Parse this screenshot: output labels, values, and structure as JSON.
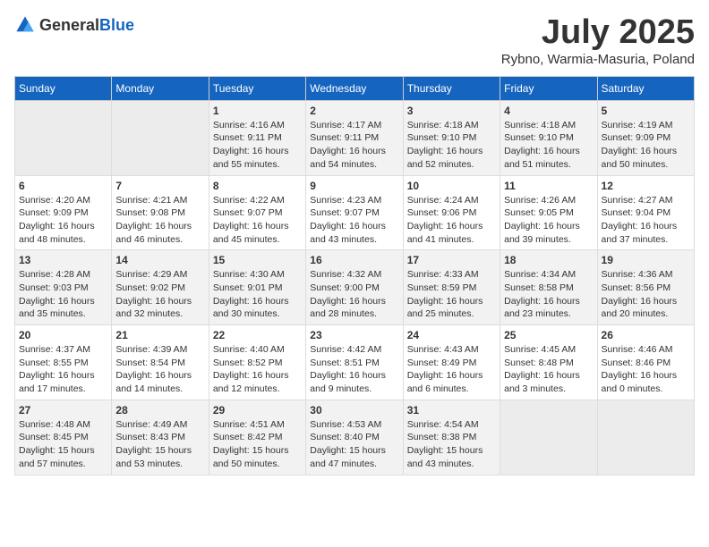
{
  "header": {
    "logo_general": "General",
    "logo_blue": "Blue",
    "month_year": "July 2025",
    "location": "Rybno, Warmia-Masuria, Poland"
  },
  "weekdays": [
    "Sunday",
    "Monday",
    "Tuesday",
    "Wednesday",
    "Thursday",
    "Friday",
    "Saturday"
  ],
  "weeks": [
    [
      {
        "day": "",
        "info": ""
      },
      {
        "day": "",
        "info": ""
      },
      {
        "day": "1",
        "info": "Sunrise: 4:16 AM\nSunset: 9:11 PM\nDaylight: 16 hours\nand 55 minutes."
      },
      {
        "day": "2",
        "info": "Sunrise: 4:17 AM\nSunset: 9:11 PM\nDaylight: 16 hours\nand 54 minutes."
      },
      {
        "day": "3",
        "info": "Sunrise: 4:18 AM\nSunset: 9:10 PM\nDaylight: 16 hours\nand 52 minutes."
      },
      {
        "day": "4",
        "info": "Sunrise: 4:18 AM\nSunset: 9:10 PM\nDaylight: 16 hours\nand 51 minutes."
      },
      {
        "day": "5",
        "info": "Sunrise: 4:19 AM\nSunset: 9:09 PM\nDaylight: 16 hours\nand 50 minutes."
      }
    ],
    [
      {
        "day": "6",
        "info": "Sunrise: 4:20 AM\nSunset: 9:09 PM\nDaylight: 16 hours\nand 48 minutes."
      },
      {
        "day": "7",
        "info": "Sunrise: 4:21 AM\nSunset: 9:08 PM\nDaylight: 16 hours\nand 46 minutes."
      },
      {
        "day": "8",
        "info": "Sunrise: 4:22 AM\nSunset: 9:07 PM\nDaylight: 16 hours\nand 45 minutes."
      },
      {
        "day": "9",
        "info": "Sunrise: 4:23 AM\nSunset: 9:07 PM\nDaylight: 16 hours\nand 43 minutes."
      },
      {
        "day": "10",
        "info": "Sunrise: 4:24 AM\nSunset: 9:06 PM\nDaylight: 16 hours\nand 41 minutes."
      },
      {
        "day": "11",
        "info": "Sunrise: 4:26 AM\nSunset: 9:05 PM\nDaylight: 16 hours\nand 39 minutes."
      },
      {
        "day": "12",
        "info": "Sunrise: 4:27 AM\nSunset: 9:04 PM\nDaylight: 16 hours\nand 37 minutes."
      }
    ],
    [
      {
        "day": "13",
        "info": "Sunrise: 4:28 AM\nSunset: 9:03 PM\nDaylight: 16 hours\nand 35 minutes."
      },
      {
        "day": "14",
        "info": "Sunrise: 4:29 AM\nSunset: 9:02 PM\nDaylight: 16 hours\nand 32 minutes."
      },
      {
        "day": "15",
        "info": "Sunrise: 4:30 AM\nSunset: 9:01 PM\nDaylight: 16 hours\nand 30 minutes."
      },
      {
        "day": "16",
        "info": "Sunrise: 4:32 AM\nSunset: 9:00 PM\nDaylight: 16 hours\nand 28 minutes."
      },
      {
        "day": "17",
        "info": "Sunrise: 4:33 AM\nSunset: 8:59 PM\nDaylight: 16 hours\nand 25 minutes."
      },
      {
        "day": "18",
        "info": "Sunrise: 4:34 AM\nSunset: 8:58 PM\nDaylight: 16 hours\nand 23 minutes."
      },
      {
        "day": "19",
        "info": "Sunrise: 4:36 AM\nSunset: 8:56 PM\nDaylight: 16 hours\nand 20 minutes."
      }
    ],
    [
      {
        "day": "20",
        "info": "Sunrise: 4:37 AM\nSunset: 8:55 PM\nDaylight: 16 hours\nand 17 minutes."
      },
      {
        "day": "21",
        "info": "Sunrise: 4:39 AM\nSunset: 8:54 PM\nDaylight: 16 hours\nand 14 minutes."
      },
      {
        "day": "22",
        "info": "Sunrise: 4:40 AM\nSunset: 8:52 PM\nDaylight: 16 hours\nand 12 minutes."
      },
      {
        "day": "23",
        "info": "Sunrise: 4:42 AM\nSunset: 8:51 PM\nDaylight: 16 hours\nand 9 minutes."
      },
      {
        "day": "24",
        "info": "Sunrise: 4:43 AM\nSunset: 8:49 PM\nDaylight: 16 hours\nand 6 minutes."
      },
      {
        "day": "25",
        "info": "Sunrise: 4:45 AM\nSunset: 8:48 PM\nDaylight: 16 hours\nand 3 minutes."
      },
      {
        "day": "26",
        "info": "Sunrise: 4:46 AM\nSunset: 8:46 PM\nDaylight: 16 hours\nand 0 minutes."
      }
    ],
    [
      {
        "day": "27",
        "info": "Sunrise: 4:48 AM\nSunset: 8:45 PM\nDaylight: 15 hours\nand 57 minutes."
      },
      {
        "day": "28",
        "info": "Sunrise: 4:49 AM\nSunset: 8:43 PM\nDaylight: 15 hours\nand 53 minutes."
      },
      {
        "day": "29",
        "info": "Sunrise: 4:51 AM\nSunset: 8:42 PM\nDaylight: 15 hours\nand 50 minutes."
      },
      {
        "day": "30",
        "info": "Sunrise: 4:53 AM\nSunset: 8:40 PM\nDaylight: 15 hours\nand 47 minutes."
      },
      {
        "day": "31",
        "info": "Sunrise: 4:54 AM\nSunset: 8:38 PM\nDaylight: 15 hours\nand 43 minutes."
      },
      {
        "day": "",
        "info": ""
      },
      {
        "day": "",
        "info": ""
      }
    ]
  ]
}
